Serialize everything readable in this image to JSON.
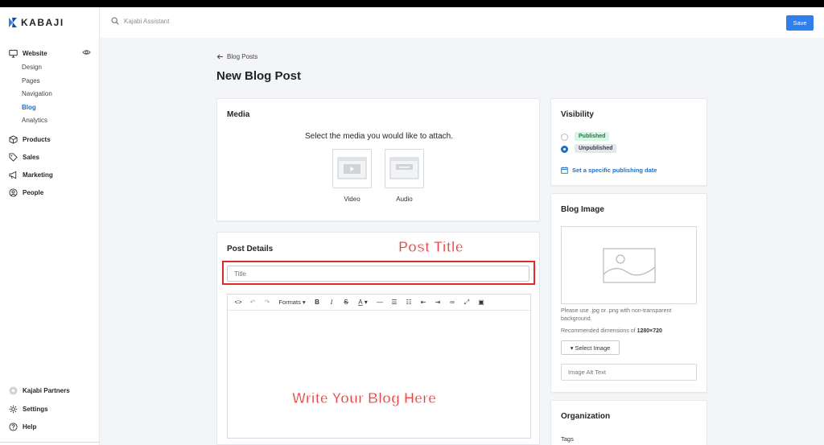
{
  "brand": {
    "name": "KABAJI",
    "accent": "#2f80ed",
    "link": "#1a6fc9"
  },
  "header": {
    "search_placeholder": "Kajabi Assistant",
    "save_label": "Save"
  },
  "sidebar": {
    "website": {
      "label": "Website",
      "items": [
        "Design",
        "Pages",
        "Navigation",
        "Blog",
        "Analytics"
      ],
      "active": "Blog"
    },
    "sections": [
      "Products",
      "Sales",
      "Marketing",
      "People"
    ],
    "bottom": [
      "Kajabi Partners",
      "Settings",
      "Help"
    ]
  },
  "page": {
    "back_label": "Blog Posts",
    "title": "New Blog Post"
  },
  "media": {
    "title": "Media",
    "prompt": "Select the media you would like to attach.",
    "options": [
      "Video",
      "Audio"
    ]
  },
  "details": {
    "title": "Post Details",
    "title_placeholder": "Title",
    "toolbar_formats": "Formats",
    "annotation_title": "Post Title",
    "annotation_body": "Write Your Blog Here"
  },
  "visibility": {
    "title": "Visibility",
    "published": "Published",
    "unpublished": "Unpublished",
    "selected": "Unpublished",
    "schedule_link": "Set a specific publishing date"
  },
  "blog_image": {
    "title": "Blog Image",
    "hint": "Please use .jpg or .png with non-transparent background.",
    "dims_prefix": "Recommended dimensions of",
    "dims_value": "1280×720",
    "select_label": "▾ Select Image",
    "alt_placeholder": "Image Alt Text"
  },
  "organization": {
    "title": "Organization",
    "tags_label": "Tags"
  }
}
